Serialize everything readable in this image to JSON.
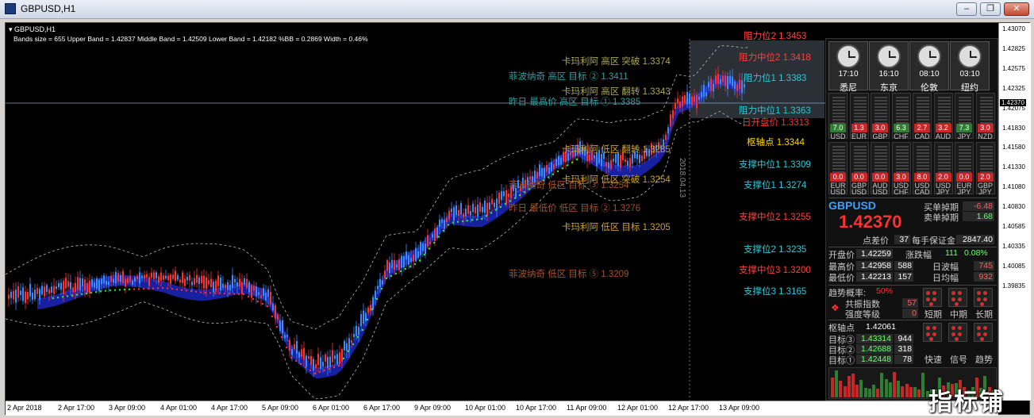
{
  "window": {
    "title": "GBPUSD,H1",
    "min_label": "–",
    "max_label": "❐",
    "close_label": "✕"
  },
  "chart": {
    "symbol_header": "▾ GBPUSD,H1",
    "bands_info": "Bands size = 655  Upper Band = 1.42837  Middle Band = 1.42509  Lower Band = 1.42182  %BB = 0.2869  Width = 0.46%",
    "vertical_date_label": "2018.04.13",
    "colors": {
      "bull": "#3c8cff",
      "bear": "#ff3030",
      "band": "#bbbbbb",
      "cloud": "#1f2bd6",
      "dots_green": "#2ee62e",
      "dots_red": "#ff2b2b"
    }
  },
  "price_axis": {
    "labels": [
      "1.43070",
      "1.42825",
      "1.42575",
      "1.42325",
      "1.42075",
      "1.41830",
      "1.41580",
      "1.41330",
      "1.41080",
      "1.40830",
      "1.40585",
      "1.40335",
      "1.40085",
      "1.39835"
    ],
    "current": "1.42370"
  },
  "time_axis": {
    "labels": [
      "2 Apr 2018",
      "2 Apr 17:00",
      "3 Apr 09:00",
      "4 Apr 01:00",
      "4 Apr 17:00",
      "5 Apr 09:00",
      "6 Apr 01:00",
      "6 Apr 17:00",
      "9 Apr 09:00",
      "10 Apr 01:00",
      "10 Apr 17:00",
      "11 Apr 09:00",
      "12 Apr 01:00",
      "12 Apr 17:00",
      "13 Apr 09:00"
    ]
  },
  "levels": [
    {
      "text": "阻力位2 1.3453",
      "color": "#ff4040"
    },
    {
      "text": "阻力中位2 1.3418",
      "color": "#ff4040"
    },
    {
      "text": "阻力位1 1.3383",
      "color": "#2ec7d6"
    },
    {
      "text": "阻力中位1 1.3363",
      "color": "#2ec7d6"
    },
    {
      "text": "日开盘价 1.3313",
      "color": "#ff3030"
    },
    {
      "text": "枢轴点 1.3344",
      "color": "#ffd400"
    },
    {
      "text": "支撑中位1 1.3309",
      "color": "#2ec7d6"
    },
    {
      "text": "支撑位1 1.3274",
      "color": "#2ec7d6"
    },
    {
      "text": "支撑中位2 1.3255",
      "color": "#ff4040"
    },
    {
      "text": "支撑位2 1.3235",
      "color": "#2ec7d6"
    },
    {
      "text": "支撑中位3 1.3200",
      "color": "#ff4040"
    },
    {
      "text": "支撑位3 1.3165",
      "color": "#2ec7d6"
    }
  ],
  "annotations": [
    {
      "text": "卡玛利阿 高区 突破  1.3374",
      "color": "#a9a65a"
    },
    {
      "text": "菲波纳奇 高区 目标 ②  1.3411",
      "color": "#2f9e9e"
    },
    {
      "text": "卡玛利阿 高区 翻转  1.3343",
      "color": "#a9a65a"
    },
    {
      "text": "昨日 最高价 高区 目标 ①  1.3385",
      "color": "#2f9e9e"
    },
    {
      "text": "卡玛利阿 低区 翻转  1.3285",
      "color": "#c8a030"
    },
    {
      "text": "菲波纳奇 低区 目标 ③  1.3254",
      "color": "#a0522d"
    },
    {
      "text": "卡玛利阿 低区 突破  1.3254",
      "color": "#c8a030"
    },
    {
      "text": "昨日 最低价 低区 目标 ②  1.3276",
      "color": "#a0522d"
    },
    {
      "text": "卡玛利阿 低区 目标  1.3205",
      "color": "#c8a030"
    },
    {
      "text": "菲波纳奇 低区 目标 ⑤  1.3209",
      "color": "#a0522d"
    }
  ],
  "panel": {
    "clocks": [
      {
        "time": "17:10",
        "city": "悉尼"
      },
      {
        "time": "16:10",
        "city": "东京"
      },
      {
        "time": "08:10",
        "city": "伦敦"
      },
      {
        "time": "03:10",
        "city": "纽约"
      }
    ],
    "strength_row1": [
      {
        "value": "7.0",
        "currency": "USD",
        "bg": "#2e7d32"
      },
      {
        "value": "1.3",
        "currency": "EUR",
        "bg": "#c62828"
      },
      {
        "value": "3.0",
        "currency": "GBP",
        "bg": "#c62828"
      },
      {
        "value": "6.3",
        "currency": "CHF",
        "bg": "#2e7d32"
      },
      {
        "value": "2.7",
        "currency": "CAD",
        "bg": "#c62828"
      },
      {
        "value": "3.2",
        "currency": "AUD",
        "bg": "#c62828"
      },
      {
        "value": "7.3",
        "currency": "JPY",
        "bg": "#2e7d32"
      },
      {
        "value": "3.0",
        "currency": "NZD",
        "bg": "#c62828"
      }
    ],
    "strength_row2": [
      {
        "value": "0.0",
        "p1": "EUR",
        "p2": "USD"
      },
      {
        "value": "0.0",
        "p1": "GBP",
        "p2": "USD"
      },
      {
        "value": "0.0",
        "p1": "AUD",
        "p2": "USD"
      },
      {
        "value": "3.0",
        "p1": "USD",
        "p2": "CHF"
      },
      {
        "value": "8.0",
        "p1": "USD",
        "p2": "CAD"
      },
      {
        "value": "2.0",
        "p1": "USD",
        "p2": "JPY"
      },
      {
        "value": "0.0",
        "p1": "EUR",
        "p2": "JPY"
      },
      {
        "value": "2.0",
        "p1": "GBP",
        "p2": "JPY"
      }
    ],
    "symbol": "GBPUSD",
    "price": "1.42370",
    "buy_swap_label": "买单掉期",
    "buy_swap": "-6.48",
    "sell_swap_label": "卖单掉期",
    "sell_swap": "1.68",
    "spread_label": "点差价",
    "spread": "37",
    "margin_label": "每手保证金",
    "margin": "2847.40",
    "open_label": "开盘价",
    "open": "1.42259",
    "change_label": "涨跌幅",
    "change_pts": "111",
    "change_pct": "0.08%",
    "high_label": "最高价",
    "high": "1.42958",
    "high_pts": "588",
    "low_label": "最低价",
    "low": "1.42213",
    "low_pts": "157",
    "day_range_label": "日波幅",
    "day_range": "745",
    "avg_range_label": "日均幅",
    "avg_range": "932",
    "trend_label": "趋势概率:",
    "trend_value": "50%",
    "resonance_label": "共振指数",
    "resonance": "57",
    "strength_level_label": "强度等级",
    "strength_level": "0",
    "periods": [
      "短期",
      "中期",
      "长期"
    ],
    "pivot_label": "枢轴点",
    "pivot": "1.42061",
    "targets": [
      {
        "label": "目标③",
        "value": "1.43314",
        "pts": "944"
      },
      {
        "label": "目标②",
        "value": "1.42688",
        "pts": "318"
      },
      {
        "label": "目标①",
        "value": "1.42448",
        "pts": "78"
      }
    ],
    "signals": [
      "快速",
      "信号",
      "趋势"
    ]
  },
  "watermark": "指标铺"
}
